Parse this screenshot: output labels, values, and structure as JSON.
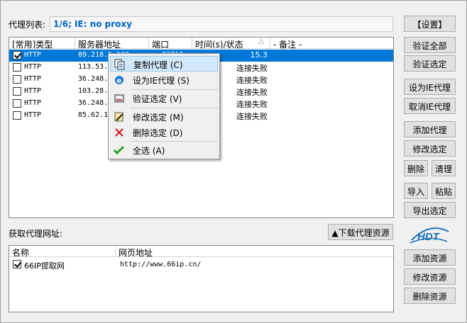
{
  "proxy_list_label": "代理列表:",
  "status": "1/6;   IE: no proxy",
  "proxy_table": {
    "headers": [
      "[常用]类型",
      "服务器地址",
      "端口",
      "时间(s)/状态",
      "- 备注 -"
    ],
    "rows": [
      {
        "checked": true,
        "type": "HTTP",
        "server": "89.218.5.109",
        "port": "83713",
        "time": "15.3",
        "note": ""
      },
      {
        "checked": false,
        "type": "HTTP",
        "server": "113.53.",
        "port": "",
        "time": "连接失败",
        "note": ""
      },
      {
        "checked": false,
        "type": "HTTP",
        "server": "36.248.",
        "port": "",
        "time": "连接失败",
        "note": ""
      },
      {
        "checked": false,
        "type": "HTTP",
        "server": "103.28.",
        "port": "",
        "time": "连接失败",
        "note": ""
      },
      {
        "checked": false,
        "type": "HTTP",
        "server": "36.248.",
        "port": "",
        "time": "连接失败",
        "note": ""
      },
      {
        "checked": false,
        "type": "HTTP",
        "server": "85.62.1",
        "port": "",
        "time": "连接失败",
        "note": ""
      }
    ]
  },
  "context_menu": {
    "items": [
      {
        "label": "复制代理 (C)",
        "icon": "copy-icon"
      },
      {
        "label": "设为IE代理 (S)",
        "icon": "ie-icon"
      },
      {
        "label": "验证选定 (V)",
        "icon": "verify-icon"
      },
      {
        "label": "修改选定 (M)",
        "icon": "edit-icon"
      },
      {
        "label": "删除选定 (D)",
        "icon": "delete-icon"
      },
      {
        "label": "全选 (A)",
        "icon": "check-all-icon"
      }
    ]
  },
  "fetch_label": "获取代理网址:",
  "download_button": "▲下载代理资源",
  "source_table": {
    "headers": [
      "名称",
      "网页地址"
    ],
    "rows": [
      {
        "checked": true,
        "name": "66IP提取网",
        "url": "http://www.66ip.cn/"
      }
    ]
  },
  "buttons": {
    "settings": "【设置】",
    "verify_all": "验证全部",
    "verify_selected": "验证选定",
    "set_ie_proxy": "设为IE代理",
    "cancel_ie_proxy": "取消IE代理",
    "add_proxy": "添加代理",
    "edit_selected": "修改选定",
    "delete": "删除",
    "clear": "清理",
    "import": "导入",
    "paste": "粘贴",
    "export_selected": "导出选定",
    "add_source": "添加资源",
    "edit_source": "修改资源",
    "delete_source": "删除资源"
  },
  "logo_text": "HDT",
  "colors": {
    "selection": "#0078d7",
    "status_text": "#0066cc",
    "logo": "#1a6fb5"
  }
}
